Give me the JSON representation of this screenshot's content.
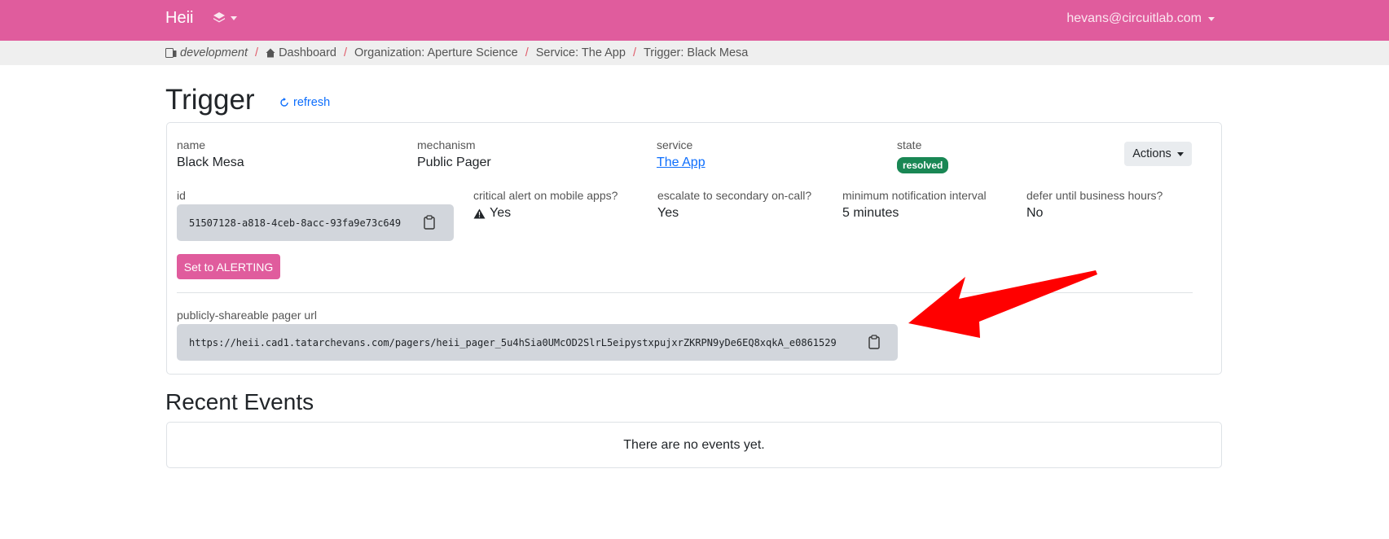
{
  "navbar": {
    "brand": "Heii",
    "user_email": "hevans@circuitlab.com",
    "bg_color": "#e05c9d"
  },
  "breadcrumb": {
    "environment": "development",
    "dashboard": "Dashboard",
    "organization": "Organization: Aperture Science",
    "service": "Service: The App",
    "trigger": "Trigger: Black Mesa",
    "separator": "/"
  },
  "header": {
    "title": "Trigger",
    "refresh_label": "refresh"
  },
  "trigger": {
    "name_label": "name",
    "name_value": "Black Mesa",
    "mechanism_label": "mechanism",
    "mechanism_value": "Public Pager",
    "service_label": "service",
    "service_value": "The App",
    "state_label": "state",
    "state_value": "resolved",
    "state_color": "#198754",
    "actions_label": "Actions",
    "id_label": "id",
    "id_value": "51507128-a818-4ceb-8acc-93fa9e73c649",
    "critical_label": "critical alert on mobile apps?",
    "critical_value": "Yes",
    "escalate_label": "escalate to secondary on-call?",
    "escalate_value": "Yes",
    "interval_label": "minimum notification interval",
    "interval_value": "5 minutes",
    "defer_label": "defer until business hours?",
    "defer_value": "No",
    "set_alerting_label": "Set to ALERTING",
    "pager_url_label": "publicly-shareable pager url",
    "pager_url_value": "https://heii.cad1.tatarchevans.com/pagers/heii_pager_5u4hSia0UMcOD2SlrL5eipystxpujxrZKRPN9yDe6EQ8xqkA_e0861529"
  },
  "events": {
    "title": "Recent Events",
    "empty_message": "There are no events yet."
  },
  "icons": {
    "layers": "layers-icon",
    "clipboard": "clipboard-icon",
    "refresh": "refresh-icon",
    "warning": "warning-icon",
    "home": "home-icon",
    "device": "device-icon",
    "annotation_arrow": "red-arrow",
    "arrow_color": "#ff0000"
  }
}
